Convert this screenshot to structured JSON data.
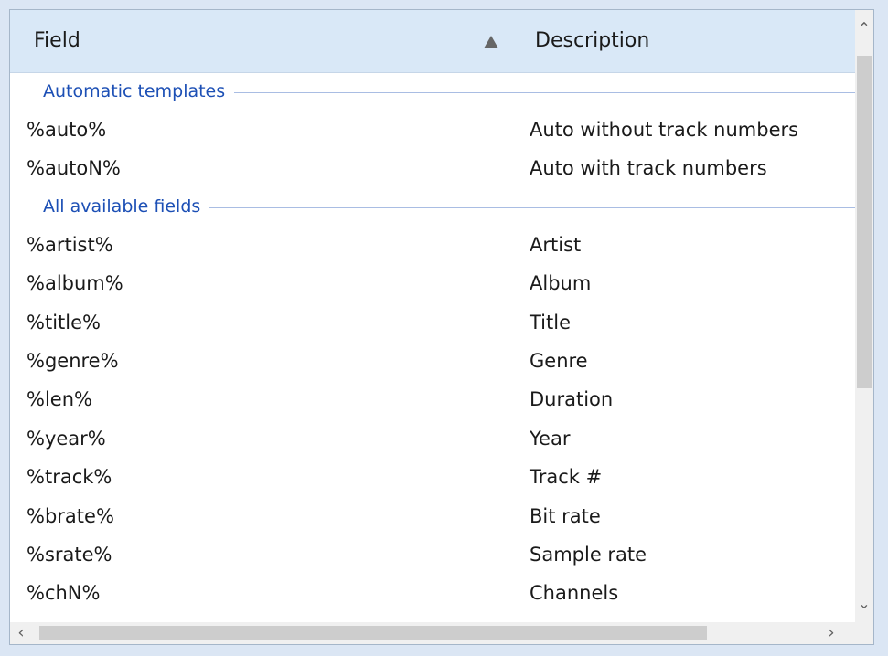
{
  "header": {
    "field_label": "Field",
    "description_label": "Description",
    "sort_icon": "triangle-up-icon"
  },
  "groups": [
    {
      "label": "Automatic templates",
      "rows": [
        {
          "field": "%auto%",
          "description": "Auto without track numbers"
        },
        {
          "field": "%autoN%",
          "description": "Auto with track numbers"
        }
      ]
    },
    {
      "label": "All available fields",
      "rows": [
        {
          "field": "%artist%",
          "description": "Artist"
        },
        {
          "field": "%album%",
          "description": "Album"
        },
        {
          "field": "%title%",
          "description": "Title"
        },
        {
          "field": "%genre%",
          "description": "Genre"
        },
        {
          "field": "%len%",
          "description": "Duration"
        },
        {
          "field": "%year%",
          "description": "Year"
        },
        {
          "field": "%track%",
          "description": "Track #"
        },
        {
          "field": "%brate%",
          "description": "Bit rate"
        },
        {
          "field": "%srate%",
          "description": "Sample rate"
        },
        {
          "field": "%chN%",
          "description": "Channels"
        }
      ]
    }
  ],
  "scrollbars": {
    "up_icon": "chevron-up-icon",
    "down_icon": "chevron-down-icon",
    "left_icon": "chevron-left-icon",
    "right_icon": "chevron-right-icon"
  },
  "colors": {
    "group_text": "#1c4fb5",
    "header_bg": "#d9e8f7",
    "frame_bg": "#dbe6f4"
  }
}
